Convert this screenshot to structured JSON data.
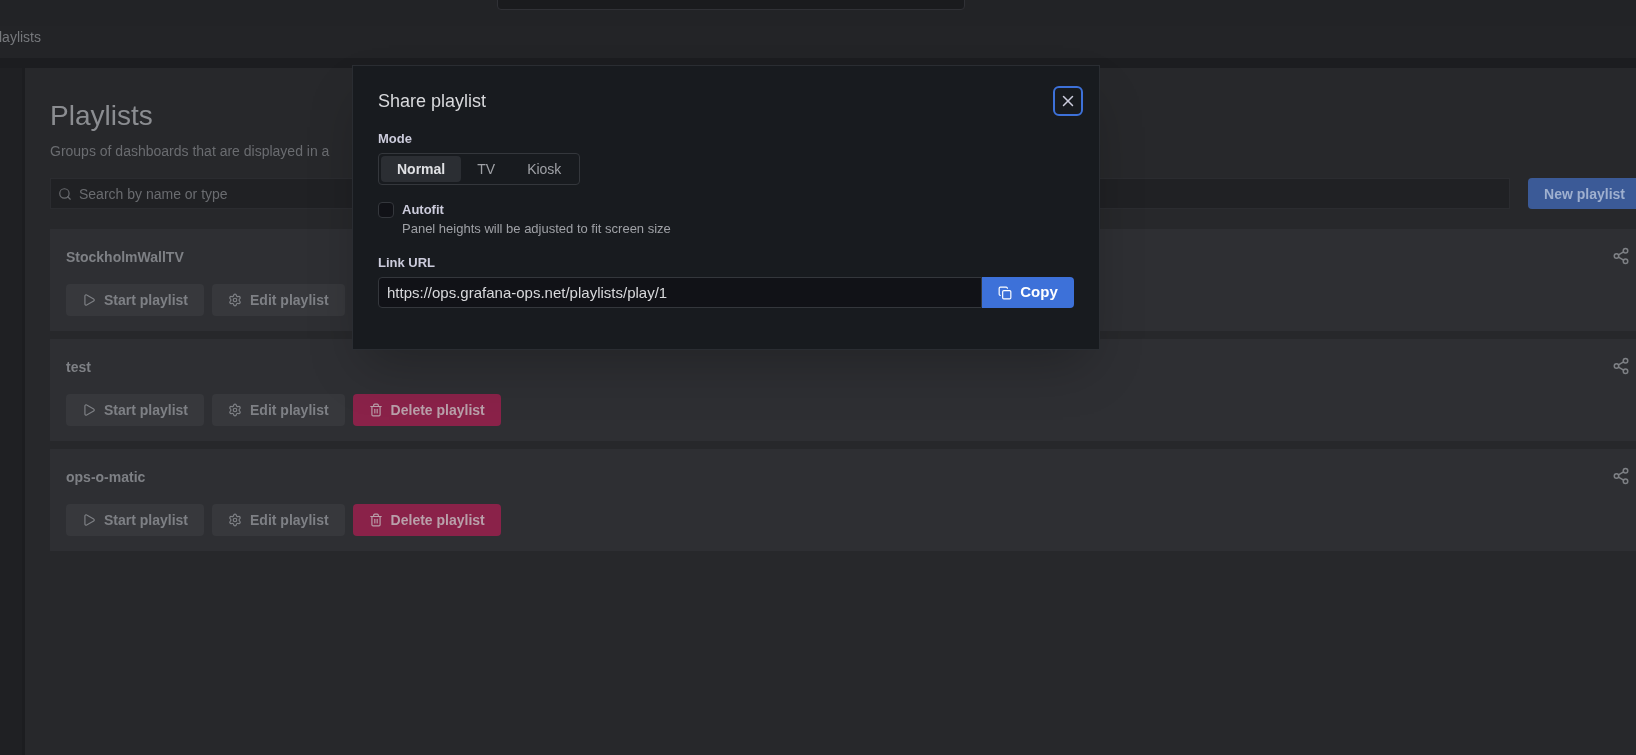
{
  "breadcrumb": "laylists",
  "page": {
    "title": "Playlists",
    "subtitle": "Groups of dashboards that are displayed in a",
    "search": {
      "placeholder": "Search by name or type"
    },
    "new_button": "New playlist"
  },
  "playlists": [
    {
      "name": "StockholmWallTV",
      "buttons": [
        {
          "kind": "start",
          "label": "Start playlist"
        },
        {
          "kind": "edit",
          "label": "Edit playlist"
        }
      ]
    },
    {
      "name": "test",
      "buttons": [
        {
          "kind": "start",
          "label": "Start playlist"
        },
        {
          "kind": "edit",
          "label": "Edit playlist"
        },
        {
          "kind": "delete",
          "label": "Delete playlist"
        }
      ]
    },
    {
      "name": "ops-o-matic",
      "buttons": [
        {
          "kind": "start",
          "label": "Start playlist"
        },
        {
          "kind": "edit",
          "label": "Edit playlist"
        },
        {
          "kind": "delete",
          "label": "Delete playlist"
        }
      ]
    }
  ],
  "dialog": {
    "title": "Share playlist",
    "mode_label": "Mode",
    "modes": [
      {
        "label": "Normal",
        "selected": true
      },
      {
        "label": "TV",
        "selected": false
      },
      {
        "label": "Kiosk",
        "selected": false
      }
    ],
    "autofit": {
      "label": "Autofit",
      "description": "Panel heights will be adjusted to fit screen size",
      "checked": false
    },
    "link_label": "Link URL",
    "link_url": "https://ops.grafana-ops.net/playlists/play/1",
    "copy_button": "Copy"
  }
}
